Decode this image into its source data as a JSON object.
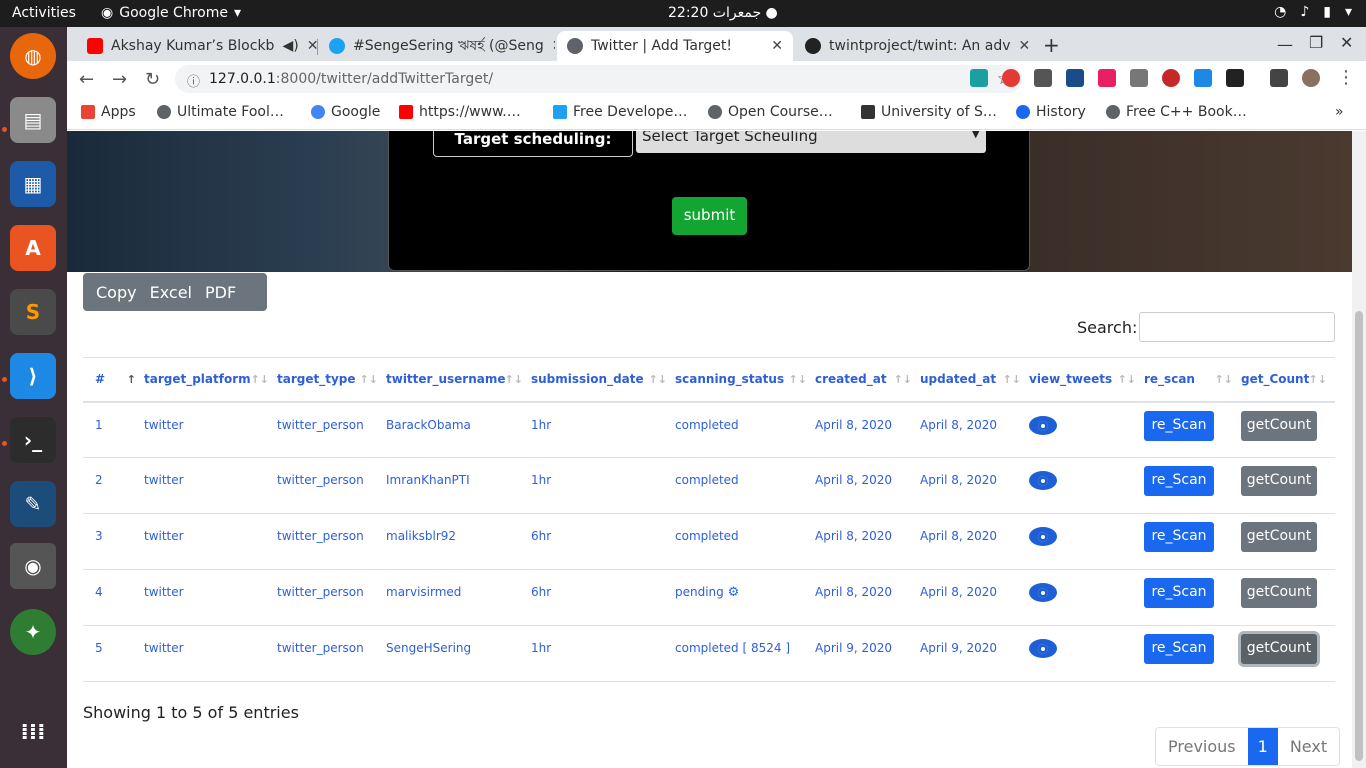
{
  "topbar": {
    "activities": "Activities",
    "app_name": "Google Chrome",
    "clock": "جمعرات 22:20"
  },
  "tabs": [
    {
      "title": "Akshay Kumar’s Blockb",
      "fav_color": "#ff0000"
    },
    {
      "title": "#SengeSering ঋষর্হ (@Seng",
      "fav_color": "#1da1f2"
    },
    {
      "title": "Twitter | Add Target!",
      "fav_color": "#5f6368"
    },
    {
      "title": "twintproject/twint: An adv",
      "fav_color": "#222222"
    }
  ],
  "omnibar": {
    "url_host": "127.0.0.1",
    "url_rest": ":8000/twitter/addTwitterTarget/"
  },
  "bookmarks": [
    {
      "label": "Apps",
      "color": "#ea4335"
    },
    {
      "label": "Ultimate Fool…",
      "color": "#5f6368"
    },
    {
      "label": "Google",
      "color": "#4285f4"
    },
    {
      "label": "https://www.…",
      "color": "#ff0000"
    },
    {
      "label": "Free Develope…",
      "color": "#1da1f2"
    },
    {
      "label": "Open Course…",
      "color": "#5f6368"
    },
    {
      "label": "University of S…",
      "color": "#333333"
    },
    {
      "label": "History",
      "color": "#1a68f0"
    },
    {
      "label": "Free C++ Book…",
      "color": "#5f6368"
    }
  ],
  "form": {
    "sched_label": "Target scheduling:",
    "sched_placeholder": "Select Target Scheuling",
    "submit": "submit"
  },
  "export": {
    "copy": "Copy",
    "excel": "Excel",
    "pdf": "PDF"
  },
  "search": {
    "label": "Search:"
  },
  "table": {
    "headers": [
      "#",
      "target_platform",
      "target_type",
      "twitter_username",
      "submission_date",
      "scanning_status",
      "created_at",
      "updated_at",
      "view_tweets",
      "re_scan",
      "get_Count"
    ],
    "rescan_label": "re_Scan",
    "getcount_label": "getCount",
    "rows": [
      {
        "n": "1",
        "platform": "twitter",
        "type": "twitter_person",
        "username": "BarackObama",
        "submission": "1hr",
        "status": "completed",
        "created": "April 8, 2020",
        "updated": "April 8, 2020"
      },
      {
        "n": "2",
        "platform": "twitter",
        "type": "twitter_person",
        "username": "ImranKhanPTI",
        "submission": "1hr",
        "status": "completed",
        "created": "April 8, 2020",
        "updated": "April 8, 2020"
      },
      {
        "n": "3",
        "platform": "twitter",
        "type": "twitter_person",
        "username": "maliksblr92",
        "submission": "6hr",
        "status": "completed",
        "created": "April 8, 2020",
        "updated": "April 8, 2020"
      },
      {
        "n": "4",
        "platform": "twitter",
        "type": "twitter_person",
        "username": "marvisirmed",
        "submission": "6hr",
        "status": "pending",
        "created": "April 8, 2020",
        "updated": "April 8, 2020"
      },
      {
        "n": "5",
        "platform": "twitter",
        "type": "twitter_person",
        "username": "SengeHSering",
        "submission": "1hr",
        "status": "completed [ 8524 ]",
        "created": "April 9, 2020",
        "updated": "April 9, 2020"
      }
    ]
  },
  "footer": {
    "info": "Showing 1 to 5 of 5 entries",
    "previous": "Previous",
    "page": "1",
    "next": "Next"
  }
}
